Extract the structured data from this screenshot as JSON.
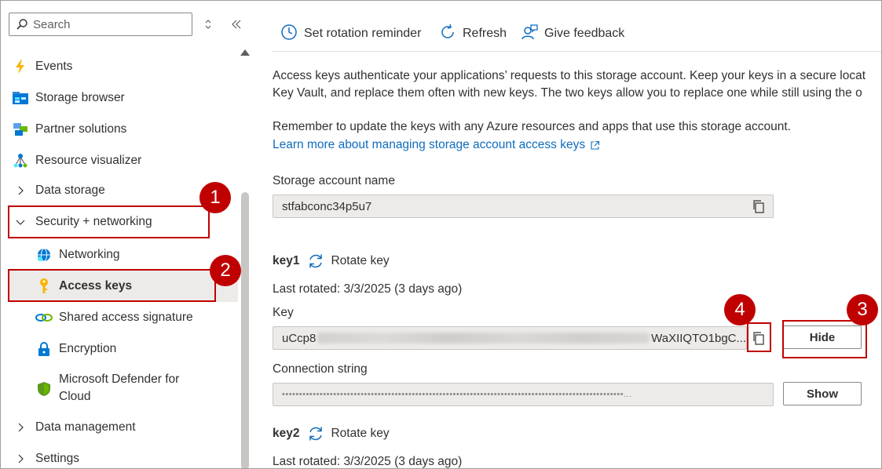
{
  "sidebar": {
    "search": {
      "placeholder": "Search"
    },
    "items": [
      {
        "label": "Events",
        "icon": "events-bolt-icon"
      },
      {
        "label": "Storage browser",
        "icon": "storage-browser-icon"
      },
      {
        "label": "Partner solutions",
        "icon": "partner-solutions-icon"
      },
      {
        "label": "Resource visualizer",
        "icon": "resource-visualizer-icon"
      },
      {
        "label": "Data storage",
        "icon": "chevron-right-icon"
      },
      {
        "label": "Security + networking",
        "icon": "chevron-down-icon"
      },
      {
        "label": "Networking",
        "icon": "networking-globe-icon"
      },
      {
        "label": "Access keys",
        "icon": "key-icon"
      },
      {
        "label": "Shared access signature",
        "icon": "link-icon"
      },
      {
        "label": "Encryption",
        "icon": "lock-icon"
      },
      {
        "label": "Microsoft Defender for Cloud",
        "label_line1": "Microsoft Defender for",
        "label_line2": "Cloud",
        "icon": "shield-icon"
      },
      {
        "label": "Data management",
        "icon": "chevron-right-icon"
      },
      {
        "label": "Settings",
        "icon": "chevron-right-icon"
      }
    ]
  },
  "toolbar": {
    "rotation_reminder": "Set rotation reminder",
    "refresh": "Refresh",
    "feedback": "Give feedback"
  },
  "main": {
    "description_line1": "Access keys authenticate your applications’ requests to this storage account. Keep your keys in a secure locat",
    "description_line2": "Key Vault, and replace them often with new keys. The two keys allow you to replace one while still using the o",
    "reminder": "Remember to update the keys with any Azure resources and apps that use this storage account.",
    "learn_more": "Learn more about managing storage account access keys",
    "account_name_label": "Storage account name",
    "account_name_value": "stfabconc34p5u7",
    "key1": {
      "name": "key1",
      "rotate_label": "Rotate key",
      "last_rotated": "Last rotated: 3/3/2025 (3 days ago)",
      "key_label": "Key",
      "key_value_start": "uCcp8",
      "key_value_end": "WaXIIQTO1bgC...",
      "hide_button": "Hide",
      "connection_string_label": "Connection string",
      "connection_string_masked": "••••••••••••••••••••••••••••••••••••••••••••••••••••••••••••••••••••••••••••••••••••••••••••••••••••...",
      "show_button": "Show"
    },
    "key2": {
      "name": "key2",
      "rotate_label": "Rotate key",
      "last_rotated": "Last rotated: 3/3/2025 (3 days ago)"
    }
  },
  "annotations": {
    "step1": "1",
    "step2": "2",
    "step3": "3",
    "step4": "4"
  },
  "colors": {
    "highlight": "#c00000",
    "link": "#0f6cbd",
    "selected_bg": "#edebe9",
    "field_bg": "#edebe9"
  }
}
